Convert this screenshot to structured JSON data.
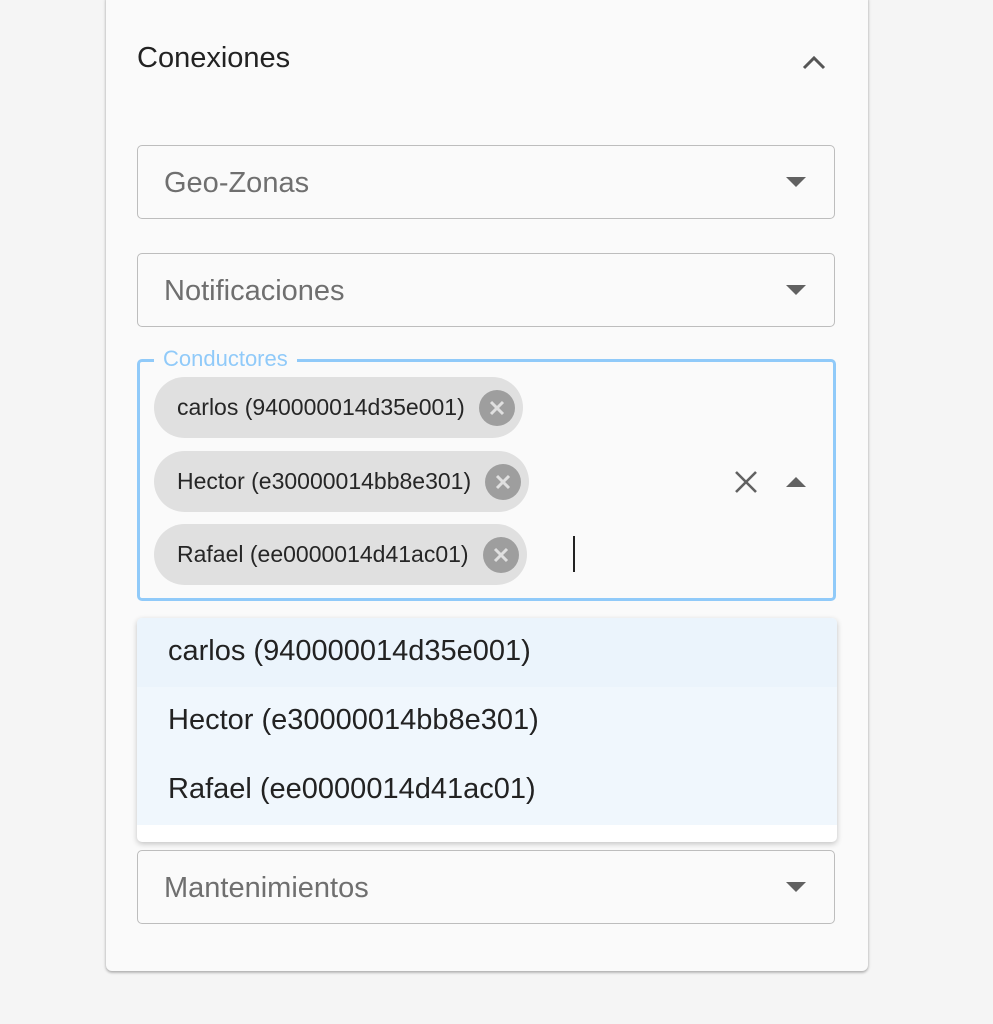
{
  "card": {
    "title": "Conexiones",
    "collapse_icon": "chevron-up-icon"
  },
  "fields": {
    "geozonas": {
      "label": "Geo-Zonas",
      "icon": "arrow-drop-down-icon"
    },
    "notificaciones": {
      "label": "Notificaciones",
      "icon": "arrow-drop-down-icon"
    },
    "conductores": {
      "label": "Conductores",
      "selected": [
        "carlos (940000014d35e001)",
        "Hector (e30000014bb8e301)",
        "Rafael (ee0000014d41ac01)"
      ],
      "clear_icon": "close-icon",
      "popup_icon": "arrow-drop-up-icon",
      "chip_delete_icon": "cancel-icon"
    },
    "mantenimientos": {
      "label": "Mantenimientos",
      "icon": "arrow-drop-down-icon"
    }
  },
  "dropdown": {
    "options": [
      "carlos (940000014d35e001)",
      "Hector (e30000014bb8e301)",
      "Rafael (ee0000014d41ac01)"
    ]
  },
  "colors": {
    "accent": "#90caf9",
    "option_selected_bg": "#f0f7fd",
    "chip_bg": "#e0e0e0"
  }
}
